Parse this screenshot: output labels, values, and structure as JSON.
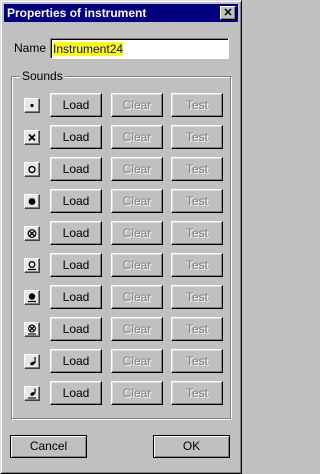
{
  "window": {
    "title": "Properties of instrument",
    "close_glyph": "✕"
  },
  "name": {
    "label": "Name",
    "value": "Instrument24"
  },
  "sounds": {
    "group_title": "Sounds",
    "rows": [
      {
        "icon": "dot-notehead-icon",
        "load": "Load",
        "clear": "Clear",
        "test": "Test"
      },
      {
        "icon": "x-notehead-icon",
        "load": "Load",
        "clear": "Clear",
        "test": "Test"
      },
      {
        "icon": "open-circle-notehead-icon",
        "load": "Load",
        "clear": "Clear",
        "test": "Test"
      },
      {
        "icon": "filled-circle-notehead-icon",
        "load": "Load",
        "clear": "Clear",
        "test": "Test"
      },
      {
        "icon": "circled-x-notehead-icon",
        "load": "Load",
        "clear": "Clear",
        "test": "Test"
      },
      {
        "icon": "open-circle-underline-notehead-icon",
        "load": "Load",
        "clear": "Clear",
        "test": "Test"
      },
      {
        "icon": "filled-circle-underline-notehead-icon",
        "load": "Load",
        "clear": "Clear",
        "test": "Test"
      },
      {
        "icon": "circled-x-underline-notehead-icon",
        "load": "Load",
        "clear": "Clear",
        "test": "Test"
      },
      {
        "icon": "stem-note-icon",
        "load": "Load",
        "clear": "Clear",
        "test": "Test"
      },
      {
        "icon": "stem-note-underline-icon",
        "load": "Load",
        "clear": "Clear",
        "test": "Test"
      }
    ]
  },
  "footer": {
    "cancel": "Cancel",
    "ok": "OK"
  }
}
